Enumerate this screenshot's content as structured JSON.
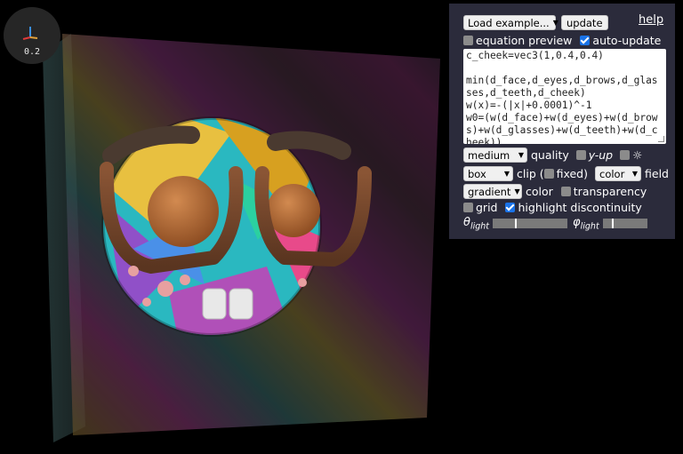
{
  "viewport": {
    "zoom_label": "0.2",
    "axis_icon": "xyz-axes-icon"
  },
  "panel": {
    "example_select": "Load example...",
    "update_button": "update",
    "help_link": "help",
    "equation_preview": {
      "label": "equation preview",
      "checked": false
    },
    "auto_update": {
      "label": "auto-update",
      "checked": true
    },
    "code": "c_cheek=vec3(1,0.4,0.4)\n\nmin(d_face,d_eyes,d_brows,d_glasses,d_teeth,d_cheek)\nw(x)=-(|x|+0.0001)^-1\nw0=(w(d_face)+w(d_eyes)+w(d_brows)+w(d_glasses)+w(d_teeth)+w(d_cheek))",
    "quality_select": "medium",
    "quality_label": "quality",
    "y_up": {
      "label": "y-up",
      "checked": false
    },
    "light_toggle": {
      "icon": "sun-icon",
      "checked": false
    },
    "clip_select": "box",
    "clip_label": "clip (",
    "fixed": {
      "label": "fixed)",
      "checked": false
    },
    "field_select": "color",
    "field_label": "field",
    "color_select": "gradient",
    "color_label": "color",
    "transparency": {
      "label": "transparency",
      "checked": false
    },
    "grid": {
      "label": "grid",
      "checked": false
    },
    "highlight_discontinuity": {
      "label": "highlight discontinuity",
      "checked": true
    },
    "theta_light": {
      "symbol": "θ",
      "sub": "light",
      "value": 0.3
    },
    "phi_light": {
      "symbol": "φ",
      "sub": "light",
      "value": 0.2
    }
  }
}
